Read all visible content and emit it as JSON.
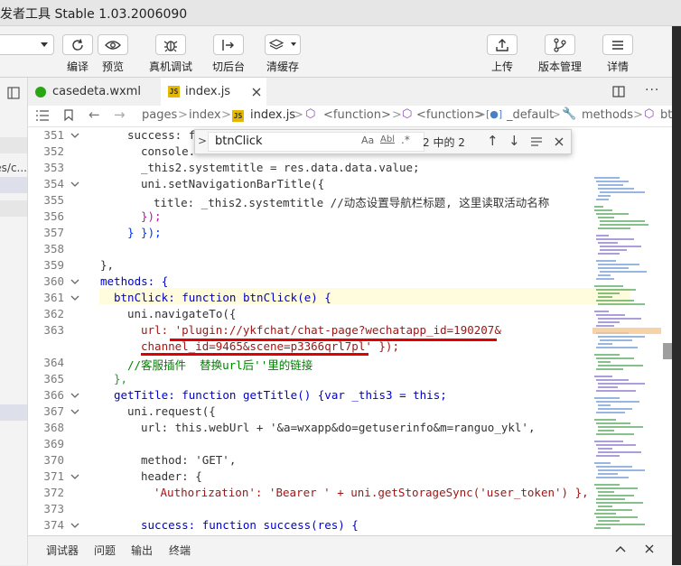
{
  "window": {
    "title": "发者工具 Stable 1.03.2006090"
  },
  "toolbar": {
    "compile": "编译",
    "preview": "预览",
    "debug": "真机调试",
    "background": "切后台",
    "clear_cache": "清缓存",
    "upload": "上传",
    "version": "版本管理",
    "details": "详情"
  },
  "sidebar": {
    "path_fragment": "es/c..."
  },
  "tabs": [
    {
      "label": "casedeta.wxml",
      "icon": "wxml-file-icon"
    },
    {
      "label": "index.js",
      "icon": "js-file-icon",
      "active": true
    }
  ],
  "breadcrumb": {
    "items": [
      "pages",
      "index",
      "index.js",
      "<function>",
      "<function>",
      "_default",
      "methods",
      "bt"
    ]
  },
  "find": {
    "query": "btnClick",
    "case_label": "Aa",
    "word_label": "Abl",
    "regex_label": ".*",
    "result": "2 中的 2"
  },
  "code": {
    "lines": [
      {
        "n": "351",
        "text": "success: f"
      },
      {
        "n": "352",
        "text": "console."
      },
      {
        "n": "353",
        "text": "_this2.systemtitle = res.data.data.value;"
      },
      {
        "n": "354",
        "text": "uni.setNavigationBarTitle({"
      },
      {
        "n": "355",
        "text": "title: _this2.systemtitle //动态设置导航栏标题, 这里读取活动名称"
      },
      {
        "n": "356",
        "text": "});"
      },
      {
        "n": "357",
        "text": "} });"
      },
      {
        "n": "358",
        "text": ""
      },
      {
        "n": "359",
        "text": "},"
      },
      {
        "n": "360",
        "text": "methods: {"
      },
      {
        "n": "361",
        "text": "btnClick: function btnClick(e) {"
      },
      {
        "n": "362",
        "text": "uni.navigateTo({"
      },
      {
        "n": "363",
        "text": "url: 'plugin://ykfchat/chat-page?wechatapp_id=190207&"
      },
      {
        "n": "",
        "text": "channel_id=9465&scene=p3366qrl7pl' });"
      },
      {
        "n": "364",
        "text": "//客服插件  替换url后''里的链接"
      },
      {
        "n": "365",
        "text": "},"
      },
      {
        "n": "366",
        "text": "getTitle: function getTitle() {var _this3 = this;"
      },
      {
        "n": "367",
        "text": "uni.request({"
      },
      {
        "n": "368",
        "text": "url: this.webUrl + '&a=wxapp&do=getuserinfo&m=ranguo_ykl',"
      },
      {
        "n": "369",
        "text": ""
      },
      {
        "n": "370",
        "text": "method: 'GET',"
      },
      {
        "n": "371",
        "text": "header: {"
      },
      {
        "n": "372",
        "text": "'Authorization': 'Bearer ' + uni.getStorageSync('user_token') },"
      },
      {
        "n": "373",
        "text": ""
      },
      {
        "n": "374",
        "text": "success: function success(res) {"
      }
    ]
  },
  "bottom_panel": {
    "tabs": [
      "调试器",
      "问题",
      "输出",
      "终端"
    ]
  }
}
